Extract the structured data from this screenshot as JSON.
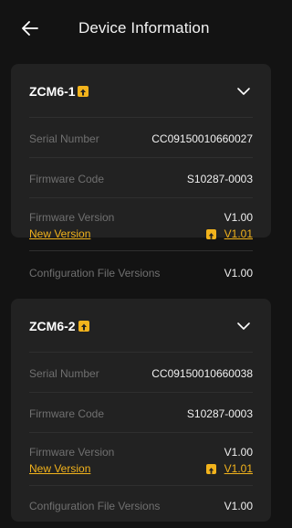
{
  "header": {
    "title": "Device Information"
  },
  "devices": [
    {
      "name": "ZCM6-1",
      "serial_label": "Serial Number",
      "serial": "CC09150010660027",
      "firmware_code_label": "Firmware Code",
      "firmware_code": "S10287-0003",
      "firmware_version_label": "Firmware Version",
      "firmware_version": "V1.00",
      "new_version_label": "New Version",
      "new_version": "V1.01",
      "config_label": "Configuration File Versions",
      "config_version": "V1.00"
    },
    {
      "name": "ZCM6-2",
      "serial_label": "Serial Number",
      "serial": "CC09150010660038",
      "firmware_code_label": "Firmware Code",
      "firmware_code": "S10287-0003",
      "firmware_version_label": "Firmware Version",
      "firmware_version": "V1.00",
      "new_version_label": "New Version",
      "new_version": "V1.01",
      "config_label": "Configuration File Versions",
      "config_version": "V1.00"
    }
  ],
  "colors": {
    "accent": "#f2b31c",
    "card": "#222222",
    "background": "#131313"
  },
  "icons": {
    "back": "arrow-left-icon",
    "expand": "chevron-down-icon",
    "update": "upgrade-icon"
  }
}
